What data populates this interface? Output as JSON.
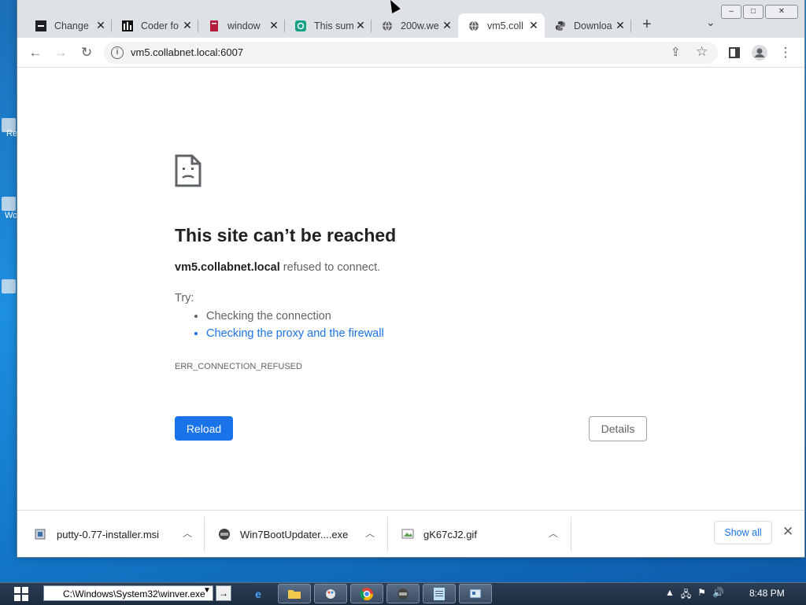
{
  "tabs": [
    {
      "title": "Change",
      "icon": "dark-square-icon"
    },
    {
      "title": "Coder fo",
      "icon": "bars-icon"
    },
    {
      "title": "window",
      "icon": "doc-icon"
    },
    {
      "title": "This sum",
      "icon": "green-app-icon"
    },
    {
      "title": "200w.we",
      "icon": "globe-icon"
    },
    {
      "title": "vm5.coll",
      "icon": "globe-icon",
      "active": true
    },
    {
      "title": "Downloa",
      "icon": "python-icon"
    }
  ],
  "address_bar": {
    "url": "vm5.collabnet.local:6007"
  },
  "error_page": {
    "title": "This site can’t be reached",
    "host": "vm5.collabnet.local",
    "message": " refused to connect.",
    "try_label": "Try:",
    "suggestions": [
      "Checking the connection",
      "Checking the proxy and the firewall"
    ],
    "error_code": "ERR_CONNECTION_REFUSED",
    "reload_label": "Reload",
    "details_label": "Details"
  },
  "downloads": {
    "items": [
      {
        "name": "putty-0.77-installer.msi"
      },
      {
        "name": "Win7BootUpdater....exe"
      },
      {
        "name": "gK67cJ2.gif"
      }
    ],
    "show_all_label": "Show all"
  },
  "taskbar": {
    "run_path": "C:\\Windows\\System32\\winver.exe",
    "clock": "8:48 PM"
  },
  "desktop_labels": [
    "Re",
    "Wo"
  ],
  "colors": {
    "accent": "#1a73e8",
    "tabbar_bg": "#dee1e6"
  }
}
